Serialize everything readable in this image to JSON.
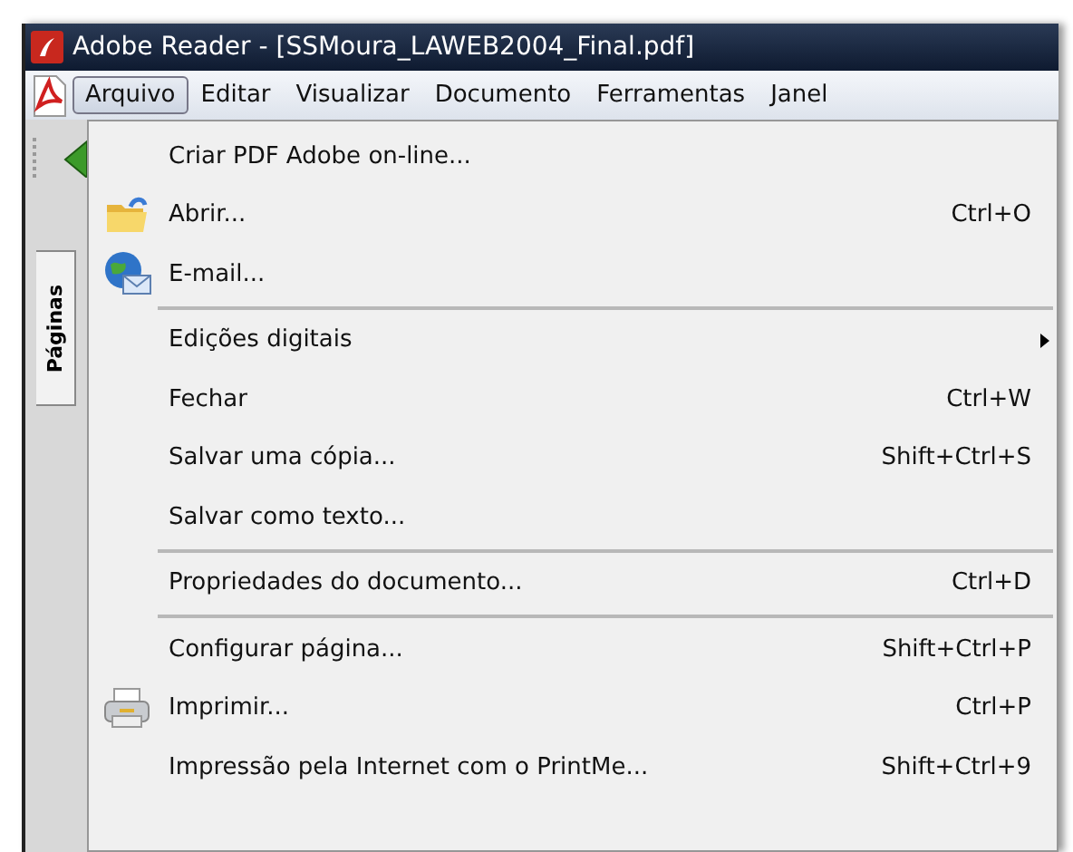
{
  "window": {
    "title": "Adobe Reader - [SSMoura_LAWEB2004_Final.pdf]"
  },
  "menubar": [
    {
      "label": "Arquivo",
      "selected": true
    },
    {
      "label": "Editar",
      "selected": false
    },
    {
      "label": "Visualizar",
      "selected": false
    },
    {
      "label": "Documento",
      "selected": false
    },
    {
      "label": "Ferramentas",
      "selected": false
    },
    {
      "label": "Janel",
      "selected": false
    }
  ],
  "side_panel": {
    "tab": "Páginas"
  },
  "menu": [
    {
      "kind": "item",
      "label": "Criar PDF Adobe on-line...",
      "icon": false
    },
    {
      "kind": "item",
      "label": "Abrir...",
      "shortcut": "Ctrl+O",
      "icon": true
    },
    {
      "kind": "item",
      "label": "E-mail...",
      "icon": true
    },
    {
      "kind": "separator"
    },
    {
      "kind": "submenu",
      "label": "Edições digitais",
      "icon": false
    },
    {
      "kind": "item",
      "label": "Fechar",
      "shortcut": "Ctrl+W",
      "icon": false
    },
    {
      "kind": "item",
      "label": "Salvar uma cópia...",
      "shortcut": "Shift+Ctrl+S",
      "icon": false
    },
    {
      "kind": "item",
      "label": "Salvar como texto...",
      "icon": false
    },
    {
      "kind": "separator"
    },
    {
      "kind": "item",
      "label": "Propriedades do documento...",
      "shortcut": "Ctrl+D",
      "icon": false
    },
    {
      "kind": "separator"
    },
    {
      "kind": "item",
      "label": "Configurar página...",
      "shortcut": "Shift+Ctrl+P",
      "icon": false
    },
    {
      "kind": "item",
      "label": "Imprimir...",
      "shortcut": "Ctrl+P",
      "icon": true
    },
    {
      "kind": "item",
      "label": "Impressão pela Internet com o PrintMe...",
      "shortcut": "Shift+Ctrl+9",
      "icon": false
    }
  ]
}
